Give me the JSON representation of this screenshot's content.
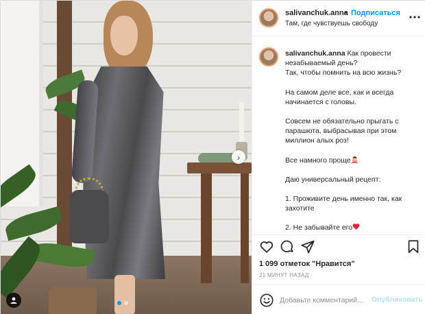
{
  "post": {
    "username": "salivanchuk.anna",
    "separator": "•",
    "follow_label": "Подписаться",
    "location": "Там, где чувствуешь свободу",
    "more_icon": "more-horizontal-icon"
  },
  "caption": {
    "username": "salivanchuk.anna",
    "lines": [
      "Как провести незабываемый день?",
      "Так, чтобы помнить на всю жизнь?",
      "",
      "На самом деле все, как и всегда начинается с головы.",
      "",
      "Совсем не обязательно прыгать с парашюта, выбрасывая при этом миллион алых роз!",
      "",
      "Все намного проще",
      "",
      "Даю универсальный рецепт:",
      "",
      "1. Проживите день именно так, как захотите",
      "",
      "2. Не забывайте его"
    ],
    "emoji_1": "woman-gesturing-no-emoji",
    "emoji_2": "red-heart-emoji"
  },
  "actions": {
    "like_icon": "heart-icon",
    "comment_icon": "comment-icon",
    "share_icon": "paper-plane-icon",
    "save_icon": "bookmark-icon"
  },
  "likes_text": "1 099 отметок \"Нравится\"",
  "timestamp": "21 МИНУТ НАЗАД",
  "comment": {
    "placeholder": "Добавьте комментарий...",
    "post_label": "Опубликовать",
    "emoji_icon": "smiley-icon"
  },
  "carousel": {
    "slides": 2,
    "active_slide": 1,
    "next_icon": "chevron-right-icon",
    "tag_icon": "user-tag-icon"
  },
  "colors": {
    "accent": "#0095f6",
    "post_disabled": "#b2dffc",
    "heart": "#ed4956"
  }
}
